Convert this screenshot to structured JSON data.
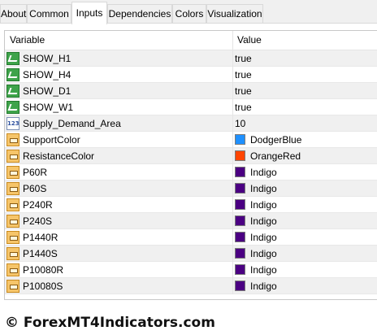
{
  "tabs": [
    {
      "label": "About"
    },
    {
      "label": "Common"
    },
    {
      "label": "Inputs"
    },
    {
      "label": "Dependencies"
    },
    {
      "label": "Colors"
    },
    {
      "label": "Visualization"
    }
  ],
  "active_tab": "Inputs",
  "table": {
    "columns": {
      "variable": "Variable",
      "value": "Value"
    },
    "rows": [
      {
        "variable": "SHOW_H1",
        "value": "true",
        "type": "bool"
      },
      {
        "variable": "SHOW_H4",
        "value": "true",
        "type": "bool"
      },
      {
        "variable": "SHOW_D1",
        "value": "true",
        "type": "bool"
      },
      {
        "variable": "SHOW_W1",
        "value": "true",
        "type": "bool"
      },
      {
        "variable": "Supply_Demand_Area",
        "value": "10",
        "type": "int"
      },
      {
        "variable": "SupportColor",
        "value": "DodgerBlue",
        "type": "color",
        "swatch": "#1e90ff"
      },
      {
        "variable": "ResistanceColor",
        "value": "OrangeRed",
        "type": "color",
        "swatch": "#ff4500"
      },
      {
        "variable": "P60R",
        "value": "Indigo",
        "type": "color",
        "swatch": "#4b0082"
      },
      {
        "variable": "P60S",
        "value": "Indigo",
        "type": "color",
        "swatch": "#4b0082"
      },
      {
        "variable": "P240R",
        "value": "Indigo",
        "type": "color",
        "swatch": "#4b0082"
      },
      {
        "variable": "P240S",
        "value": "Indigo",
        "type": "color",
        "swatch": "#4b0082"
      },
      {
        "variable": "P1440R",
        "value": "Indigo",
        "type": "color",
        "swatch": "#4b0082"
      },
      {
        "variable": "P1440S",
        "value": "Indigo",
        "type": "color",
        "swatch": "#4b0082"
      },
      {
        "variable": "P10080R",
        "value": "Indigo",
        "type": "color",
        "swatch": "#4b0082"
      },
      {
        "variable": "P10080S",
        "value": "Indigo",
        "type": "color",
        "swatch": "#4b0082"
      }
    ]
  },
  "footer": {
    "watermark": "© ForexMT4Indicators.com"
  },
  "icons": {
    "bool": "bool-param-icon",
    "int": "int-param-icon",
    "color": "color-param-icon"
  }
}
